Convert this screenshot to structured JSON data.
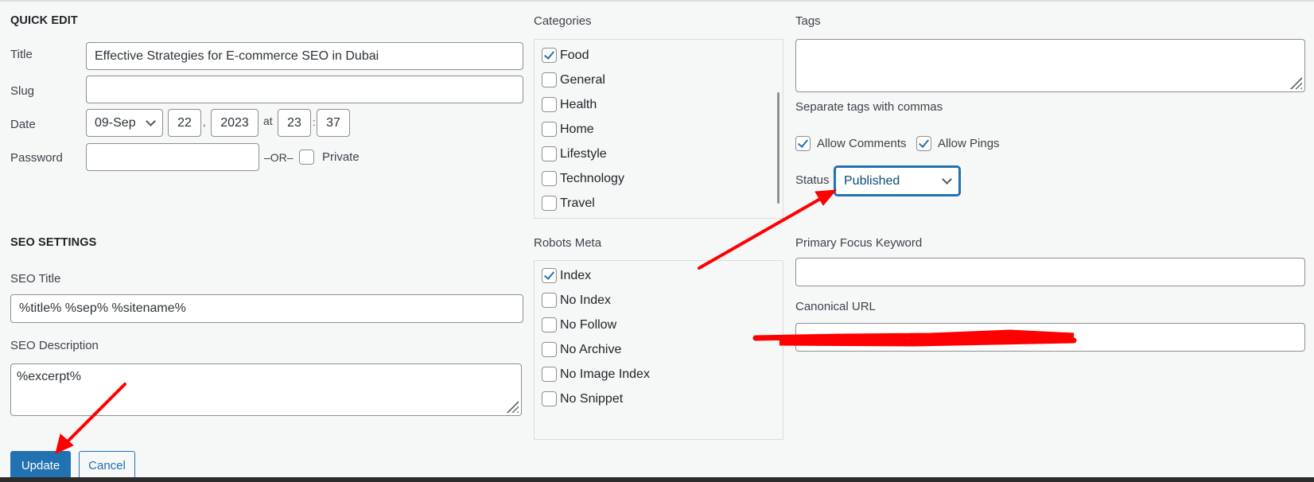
{
  "quick_edit": {
    "heading": "QUICK EDIT",
    "title_label": "Title",
    "title_value": "Effective Strategies for E-commerce SEO in Dubai",
    "slug_label": "Slug",
    "slug_value": "",
    "date_label": "Date",
    "date_month": "09-Sep",
    "date_day": "22",
    "date_sep_comma": ",",
    "date_year": "2023",
    "date_at": "at",
    "date_hour": "23",
    "date_colon": ":",
    "date_minute": "37",
    "password_label": "Password",
    "password_value": "",
    "or_text": "–OR–",
    "private_label": "Private",
    "private_checked": false
  },
  "categories": {
    "label": "Categories",
    "items": [
      {
        "label": "Food",
        "checked": true
      },
      {
        "label": "General",
        "checked": false
      },
      {
        "label": "Health",
        "checked": false
      },
      {
        "label": "Home",
        "checked": false
      },
      {
        "label": "Lifestyle",
        "checked": false
      },
      {
        "label": "Technology",
        "checked": false
      },
      {
        "label": "Travel",
        "checked": false
      }
    ]
  },
  "tags": {
    "label": "Tags",
    "value": "",
    "hint": "Separate tags with commas",
    "allow_comments_label": "Allow Comments",
    "allow_comments_checked": true,
    "allow_pings_label": "Allow Pings",
    "allow_pings_checked": true,
    "status_label": "Status",
    "status_value": "Published"
  },
  "seo": {
    "heading": "SEO SETTINGS",
    "title_label": "SEO Title",
    "title_value": "%title% %sep% %sitename%",
    "description_label": "SEO Description",
    "description_value": "%excerpt%"
  },
  "robots": {
    "label": "Robots Meta",
    "items": [
      {
        "label": "Index",
        "checked": true
      },
      {
        "label": "No Index",
        "checked": false
      },
      {
        "label": "No Follow",
        "checked": false
      },
      {
        "label": "No Archive",
        "checked": false
      },
      {
        "label": "No Image Index",
        "checked": false
      },
      {
        "label": "No Snippet",
        "checked": false
      }
    ]
  },
  "focus": {
    "keyword_label": "Primary Focus Keyword",
    "keyword_value": "",
    "canonical_label": "Canonical URL",
    "canonical_value": ""
  },
  "actions": {
    "update_label": "Update",
    "cancel_label": "Cancel"
  },
  "colors": {
    "accent": "#2271b1",
    "annotation": "#ff0000",
    "background": "#f6f7f7"
  }
}
